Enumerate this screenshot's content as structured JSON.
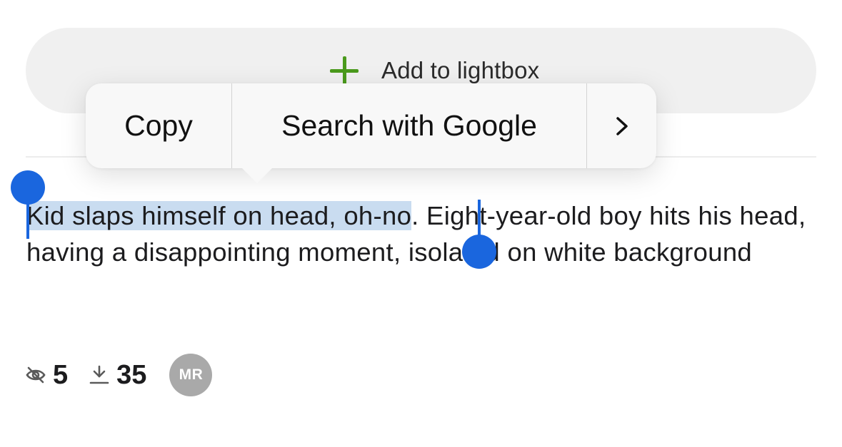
{
  "lightbox": {
    "label": "Add to lightbox",
    "icon": "plus-icon",
    "icon_color": "#4a9a1c"
  },
  "context_menu": {
    "copy_label": "Copy",
    "search_label": "Search with Google",
    "more_icon": "chevron-right-icon"
  },
  "description": {
    "selected_text": "Kid slaps himself on head, oh-no",
    "rest_text": ". Eight-year-old boy hits his head, having a disappointing moment, isolated on white background"
  },
  "selection": {
    "handle_color": "#1a66de",
    "highlight_color": "#c9dcf0"
  },
  "stats": {
    "views_icon": "views-icon",
    "views_count": "5",
    "downloads_icon": "download-icon",
    "downloads_count": "35",
    "avatar_initials": "MR"
  }
}
